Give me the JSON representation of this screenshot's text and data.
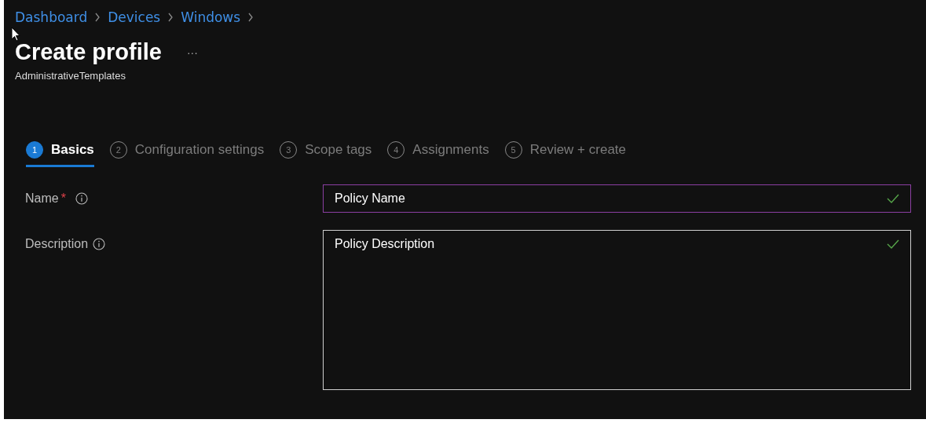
{
  "breadcrumb": [
    "Dashboard",
    "Devices",
    "Windows"
  ],
  "title": "Create profile",
  "more": "···",
  "subtitle": "AdministrativeTemplates",
  "tabs": [
    {
      "number": "1",
      "label": "Basics",
      "selected": true
    },
    {
      "number": "2",
      "label": "Configuration settings",
      "selected": false
    },
    {
      "number": "3",
      "label": "Scope tags",
      "selected": false
    },
    {
      "number": "4",
      "label": "Assignments",
      "selected": false
    },
    {
      "number": "5",
      "label": "Review + create",
      "selected": false
    }
  ],
  "fields": [
    {
      "kind": "input",
      "label": "Name",
      "required_mark": "*",
      "value": "Policy Name",
      "focused": true,
      "valid": true
    },
    {
      "kind": "textarea",
      "label": "Description",
      "value": "Policy Description",
      "focused": false,
      "valid": true
    }
  ]
}
